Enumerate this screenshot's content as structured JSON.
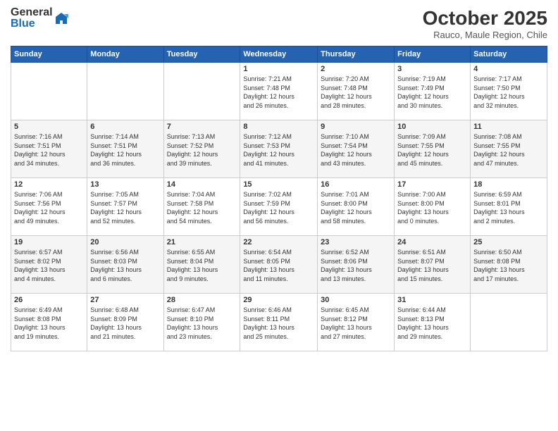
{
  "logo": {
    "general": "General",
    "blue": "Blue"
  },
  "title": "October 2025",
  "subtitle": "Rauco, Maule Region, Chile",
  "headers": [
    "Sunday",
    "Monday",
    "Tuesday",
    "Wednesday",
    "Thursday",
    "Friday",
    "Saturday"
  ],
  "weeks": [
    [
      {
        "day": "",
        "info": ""
      },
      {
        "day": "",
        "info": ""
      },
      {
        "day": "",
        "info": ""
      },
      {
        "day": "1",
        "info": "Sunrise: 7:21 AM\nSunset: 7:48 PM\nDaylight: 12 hours\nand 26 minutes."
      },
      {
        "day": "2",
        "info": "Sunrise: 7:20 AM\nSunset: 7:48 PM\nDaylight: 12 hours\nand 28 minutes."
      },
      {
        "day": "3",
        "info": "Sunrise: 7:19 AM\nSunset: 7:49 PM\nDaylight: 12 hours\nand 30 minutes."
      },
      {
        "day": "4",
        "info": "Sunrise: 7:17 AM\nSunset: 7:50 PM\nDaylight: 12 hours\nand 32 minutes."
      }
    ],
    [
      {
        "day": "5",
        "info": "Sunrise: 7:16 AM\nSunset: 7:51 PM\nDaylight: 12 hours\nand 34 minutes."
      },
      {
        "day": "6",
        "info": "Sunrise: 7:14 AM\nSunset: 7:51 PM\nDaylight: 12 hours\nand 36 minutes."
      },
      {
        "day": "7",
        "info": "Sunrise: 7:13 AM\nSunset: 7:52 PM\nDaylight: 12 hours\nand 39 minutes."
      },
      {
        "day": "8",
        "info": "Sunrise: 7:12 AM\nSunset: 7:53 PM\nDaylight: 12 hours\nand 41 minutes."
      },
      {
        "day": "9",
        "info": "Sunrise: 7:10 AM\nSunset: 7:54 PM\nDaylight: 12 hours\nand 43 minutes."
      },
      {
        "day": "10",
        "info": "Sunrise: 7:09 AM\nSunset: 7:55 PM\nDaylight: 12 hours\nand 45 minutes."
      },
      {
        "day": "11",
        "info": "Sunrise: 7:08 AM\nSunset: 7:55 PM\nDaylight: 12 hours\nand 47 minutes."
      }
    ],
    [
      {
        "day": "12",
        "info": "Sunrise: 7:06 AM\nSunset: 7:56 PM\nDaylight: 12 hours\nand 49 minutes."
      },
      {
        "day": "13",
        "info": "Sunrise: 7:05 AM\nSunset: 7:57 PM\nDaylight: 12 hours\nand 52 minutes."
      },
      {
        "day": "14",
        "info": "Sunrise: 7:04 AM\nSunset: 7:58 PM\nDaylight: 12 hours\nand 54 minutes."
      },
      {
        "day": "15",
        "info": "Sunrise: 7:02 AM\nSunset: 7:59 PM\nDaylight: 12 hours\nand 56 minutes."
      },
      {
        "day": "16",
        "info": "Sunrise: 7:01 AM\nSunset: 8:00 PM\nDaylight: 12 hours\nand 58 minutes."
      },
      {
        "day": "17",
        "info": "Sunrise: 7:00 AM\nSunset: 8:00 PM\nDaylight: 13 hours\nand 0 minutes."
      },
      {
        "day": "18",
        "info": "Sunrise: 6:59 AM\nSunset: 8:01 PM\nDaylight: 13 hours\nand 2 minutes."
      }
    ],
    [
      {
        "day": "19",
        "info": "Sunrise: 6:57 AM\nSunset: 8:02 PM\nDaylight: 13 hours\nand 4 minutes."
      },
      {
        "day": "20",
        "info": "Sunrise: 6:56 AM\nSunset: 8:03 PM\nDaylight: 13 hours\nand 6 minutes."
      },
      {
        "day": "21",
        "info": "Sunrise: 6:55 AM\nSunset: 8:04 PM\nDaylight: 13 hours\nand 9 minutes."
      },
      {
        "day": "22",
        "info": "Sunrise: 6:54 AM\nSunset: 8:05 PM\nDaylight: 13 hours\nand 11 minutes."
      },
      {
        "day": "23",
        "info": "Sunrise: 6:52 AM\nSunset: 8:06 PM\nDaylight: 13 hours\nand 13 minutes."
      },
      {
        "day": "24",
        "info": "Sunrise: 6:51 AM\nSunset: 8:07 PM\nDaylight: 13 hours\nand 15 minutes."
      },
      {
        "day": "25",
        "info": "Sunrise: 6:50 AM\nSunset: 8:08 PM\nDaylight: 13 hours\nand 17 minutes."
      }
    ],
    [
      {
        "day": "26",
        "info": "Sunrise: 6:49 AM\nSunset: 8:08 PM\nDaylight: 13 hours\nand 19 minutes."
      },
      {
        "day": "27",
        "info": "Sunrise: 6:48 AM\nSunset: 8:09 PM\nDaylight: 13 hours\nand 21 minutes."
      },
      {
        "day": "28",
        "info": "Sunrise: 6:47 AM\nSunset: 8:10 PM\nDaylight: 13 hours\nand 23 minutes."
      },
      {
        "day": "29",
        "info": "Sunrise: 6:46 AM\nSunset: 8:11 PM\nDaylight: 13 hours\nand 25 minutes."
      },
      {
        "day": "30",
        "info": "Sunrise: 6:45 AM\nSunset: 8:12 PM\nDaylight: 13 hours\nand 27 minutes."
      },
      {
        "day": "31",
        "info": "Sunrise: 6:44 AM\nSunset: 8:13 PM\nDaylight: 13 hours\nand 29 minutes."
      },
      {
        "day": "",
        "info": ""
      }
    ]
  ]
}
